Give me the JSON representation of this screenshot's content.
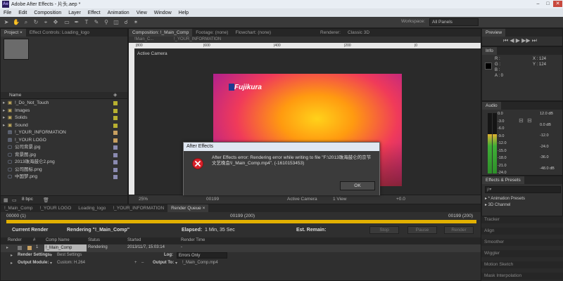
{
  "window": {
    "app_logo": "Ae",
    "title": "Adobe After Effects - 片头.aep *",
    "controls": [
      "–",
      "□",
      "✕"
    ]
  },
  "menu": [
    "File",
    "Edit",
    "Composition",
    "Layer",
    "Effect",
    "Animation",
    "View",
    "Window",
    "Help"
  ],
  "toolbar": {
    "workspace_label": "Workspace:",
    "workspace_value": "All Panels"
  },
  "project": {
    "tabs": [
      "Project ×",
      "Effect Controls: Loading_logo"
    ],
    "column_name": "Name",
    "items": [
      {
        "name": "!_Do_Not_Touch",
        "type": "folder",
        "color": "#b8b030"
      },
      {
        "name": "Images",
        "type": "folder",
        "color": "#b8b030"
      },
      {
        "name": "Solids",
        "type": "folder",
        "color": "#b8b030"
      },
      {
        "name": "Sound",
        "type": "folder",
        "color": "#b8b030"
      },
      {
        "name": "!_YOUR_INFORMATION",
        "type": "comp",
        "color": "#c8a060"
      },
      {
        "name": "!_YOUR LOGO",
        "type": "comp",
        "color": "#c8a060"
      },
      {
        "name": "公司背景.jpg",
        "type": "file",
        "color": "#8a8ab0"
      },
      {
        "name": "背景图.jpg",
        "type": "file",
        "color": "#8a8ab0"
      },
      {
        "name": "2013珠海鼓仑2.png",
        "type": "file",
        "color": "#8a8ab0"
      },
      {
        "name": "公司图标.png",
        "type": "file",
        "color": "#8a8ab0"
      },
      {
        "name": "中国梦.png",
        "type": "file",
        "color": "#8a8ab0"
      }
    ],
    "bpc": "8 bpc"
  },
  "composition": {
    "tabs": [
      "Composition: !_Main_Comp",
      "Footage: (none)",
      "Flowchart: (none)",
      "Renderer:",
      "Classic 3D"
    ],
    "breadcrumbs": [
      "!Main_C...",
      "!_YOUR_INFORMATION"
    ],
    "active_camera": "Active Camera",
    "logo_text": "Fujikura",
    "zoom": "25%",
    "timecode": "00199",
    "view": "Active Camera",
    "views": "1 View",
    "exposure": "+0.0"
  },
  "dialog": {
    "title": "After Effects",
    "message": "After Effects error: Rendering error while writing to file \"F:\\2013珠海鼓仑的京节文艺晚会\\!_Main_Comp.mp4\". (-1610153453)",
    "ok_label": "OK"
  },
  "timeline": {
    "tabs": [
      "!_Main_Comp",
      "!_YOUR LOGO",
      "Loading_logo",
      "!_YOUR_INFORMATION",
      "Render Queue ×"
    ],
    "start_time": "00000 (1)",
    "current_time": "00199 (200)",
    "end_time": "00199 (200)",
    "current_render_label": "Current Render",
    "rendering_label": "Rendering \"!_Main_Comp\"",
    "elapsed_label": "Elapsed:",
    "elapsed_value": "1 Min, 35 Sec",
    "remain_label": "Est. Remain:",
    "stop_label": "Stop",
    "pause_label": "Pause",
    "render_label": "Render",
    "columns": [
      "Render",
      "#",
      "Comp Name",
      "Status",
      "Started",
      "Render Time"
    ],
    "queue_item": {
      "index": "1",
      "comp": "!_Main_Comp",
      "status": "Rendering",
      "started": "2013/11/7, 15:03:14",
      "render_time": "-"
    },
    "render_settings_label": "Render Settings:",
    "render_settings_value": "Best Settings",
    "log_label": "Log:",
    "log_value": "Errors Only",
    "output_module_label": "Output Module:",
    "output_module_value": "Custom: H.264",
    "output_to_label": "Output To:",
    "output_to_value": "!_Main_Comp.mp4"
  },
  "info": {
    "tabs": [
      "Preview",
      "Info"
    ],
    "rgb_labels": [
      "R :",
      "G :",
      "B :",
      "A : 0"
    ],
    "x_value": "X : 124",
    "y_value": "Y : 124"
  },
  "audio": {
    "tab": "Audio",
    "left_scale": [
      "0.0",
      "-3.0",
      "-6.0",
      "-9.0",
      "-12.0",
      "-15.0",
      "-18.0",
      "-21.0",
      "-24.0"
    ],
    "right_scale": [
      "12.0 dB",
      "0.0 dB",
      "-12.0",
      "-24.0",
      "-36.0",
      "-48.0 dB"
    ],
    "levels": [
      0.65,
      0.65
    ]
  },
  "effects": {
    "tab": "Effects & Presets",
    "search_placeholder": "ρ▾",
    "items": [
      "▸ * Animation Presets",
      "▸ 3D Channel"
    ]
  },
  "right_stack": [
    "Tracker",
    "Align",
    "Smoother",
    "Wiggler",
    "Motion Sketch",
    "Mask Interpolation"
  ]
}
